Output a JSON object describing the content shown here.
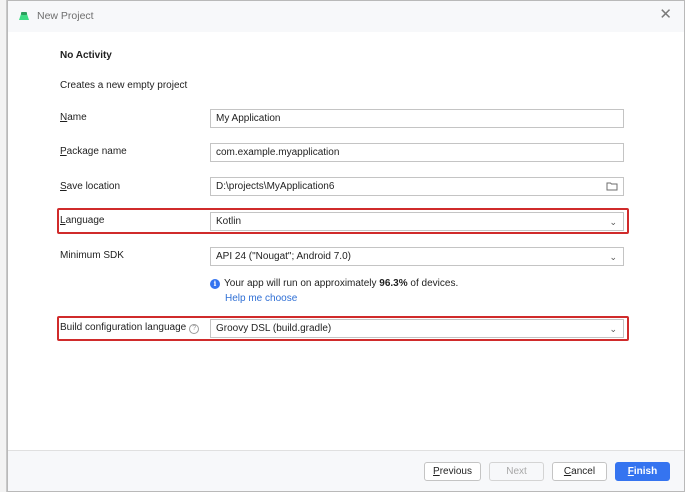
{
  "window": {
    "title": "New Project",
    "close_glyph": "✕"
  },
  "template": {
    "heading": "No Activity",
    "description": "Creates a new empty project"
  },
  "form": {
    "name": {
      "label_first": "N",
      "label_rest": "ame",
      "value": "My Application"
    },
    "package": {
      "label_first": "P",
      "label_rest": "ackage name",
      "value": "com.example.myapplication"
    },
    "save_location": {
      "label_first": "S",
      "label_rest": "ave location",
      "value": "D:\\projects\\MyApplication6"
    },
    "language": {
      "label_first": "L",
      "label_rest": "anguage",
      "value": "Kotlin"
    },
    "min_sdk": {
      "label": "Minimum SDK",
      "value": "API 24 (\"Nougat\"; Android 7.0)"
    },
    "sdk_info": {
      "prefix": "Your app will run on approximately ",
      "percent": "96.3%",
      "suffix": " of devices."
    },
    "help_link": "Help me choose",
    "build_lang": {
      "label": "Build configuration language",
      "value": "Groovy DSL (build.gradle)"
    }
  },
  "buttons": {
    "previous": {
      "first": "P",
      "rest": "revious"
    },
    "next": "Next",
    "cancel": {
      "first": "C",
      "rest": "ancel"
    },
    "finish": {
      "first": "F",
      "rest": "inish"
    }
  },
  "colors": {
    "accent": "#3574f0",
    "highlight": "#d02b2b"
  }
}
